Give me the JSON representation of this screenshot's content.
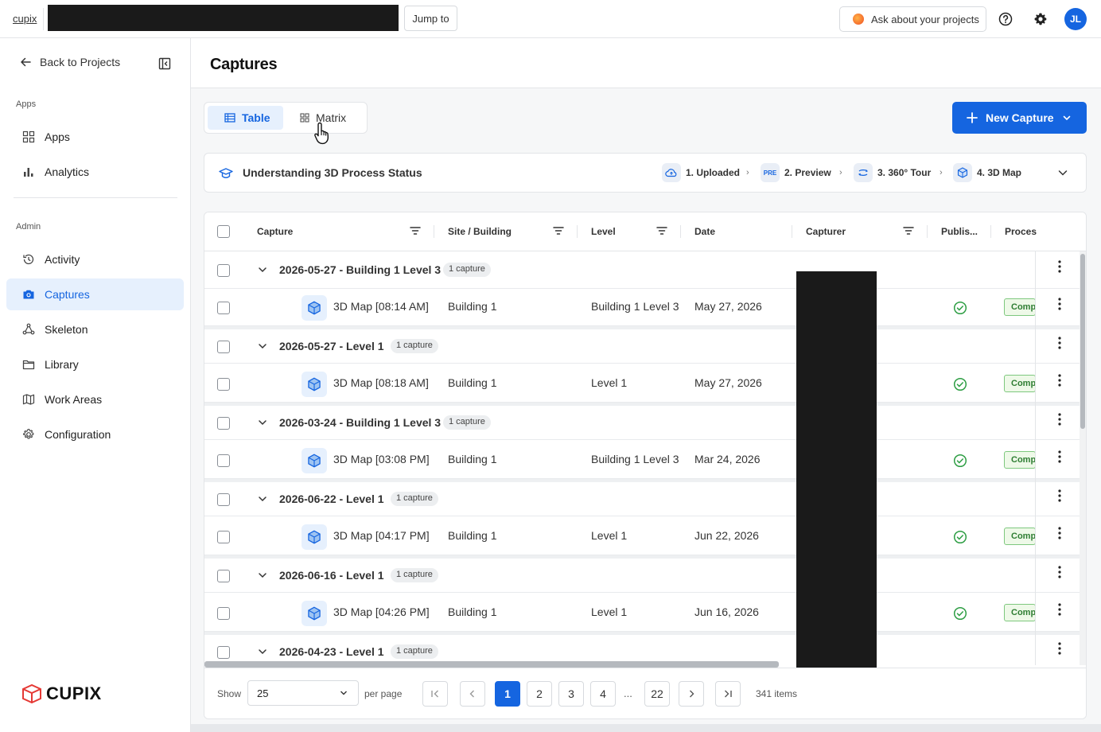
{
  "topbar": {
    "brand": "cupix",
    "jump_label": "Jump to",
    "ask_label": "Ask about your projects",
    "avatar_initials": "JL"
  },
  "sidebar": {
    "back_label": "Back to Projects",
    "section_apps": "Apps",
    "section_admin": "Admin",
    "items": [
      {
        "label": "Apps",
        "icon": "grid-icon"
      },
      {
        "label": "Analytics",
        "icon": "bar-chart-icon"
      },
      {
        "label": "Activity",
        "icon": "history-icon"
      },
      {
        "label": "Captures",
        "icon": "camera-icon",
        "active": true
      },
      {
        "label": "Skeleton",
        "icon": "skeleton-icon"
      },
      {
        "label": "Library",
        "icon": "folder-icon"
      },
      {
        "label": "Work Areas",
        "icon": "map-icon"
      },
      {
        "label": "Configuration",
        "icon": "gear-icon"
      }
    ],
    "logo_text": "CUPIX"
  },
  "page": {
    "title": "Captures",
    "view_table": "Table",
    "view_matrix": "Matrix",
    "new_capture": "New Capture"
  },
  "status": {
    "title": "Understanding 3D Process Status",
    "steps": [
      {
        "label": "1. Uploaded",
        "badge": ""
      },
      {
        "label": "2. Preview",
        "badge": "PRE"
      },
      {
        "label": "3. 360° Tour",
        "badge": ""
      },
      {
        "label": "4. 3D Map",
        "badge": ""
      }
    ]
  },
  "table": {
    "columns": [
      "Capture",
      "Site / Building",
      "Level",
      "Date",
      "Capturer",
      "Publis...",
      "Proces"
    ],
    "groups": [
      {
        "label": "2026-05-27 - Building 1 Level 3",
        "count": "1 capture",
        "capture": {
          "name": "3D Map [08:14 AM]",
          "site": "Building 1",
          "level": "Building 1 Level 3",
          "date": "May 27, 2026",
          "process": "Comp"
        }
      },
      {
        "label": "2026-05-27 - Level 1",
        "count": "1 capture",
        "capture": {
          "name": "3D Map [08:18 AM]",
          "site": "Building 1",
          "level": "Level 1",
          "date": "May 27, 2026",
          "process": "Comp"
        }
      },
      {
        "label": "2026-03-24 - Building 1 Level 3",
        "count": "1 capture",
        "capture": {
          "name": "3D Map [03:08 PM]",
          "site": "Building 1",
          "level": "Building 1 Level 3",
          "date": "Mar 24, 2026",
          "process": "Comp"
        }
      },
      {
        "label": "2026-06-22 - Level 1",
        "count": "1 capture",
        "capture": {
          "name": "3D Map [04:17 PM]",
          "site": "Building 1",
          "level": "Level 1",
          "date": "Jun 22, 2026",
          "process": "Comp"
        }
      },
      {
        "label": "2026-06-16 - Level 1",
        "count": "1 capture",
        "capture": {
          "name": "3D Map [04:26 PM]",
          "site": "Building 1",
          "level": "Level 1",
          "date": "Jun 16, 2026",
          "process": "Comp"
        }
      },
      {
        "label": "2026-04-23 - Level 1",
        "count": "1 capture"
      }
    ]
  },
  "pager": {
    "show_label": "Show",
    "per_page_value": "25",
    "per_page_label": "per page",
    "pages": [
      "1",
      "2",
      "3",
      "4"
    ],
    "ellipsis": "...",
    "last_page": "22",
    "items_label": "341 items"
  },
  "colors": {
    "accent": "#1565e0",
    "complete_green": "#2e7d32"
  }
}
